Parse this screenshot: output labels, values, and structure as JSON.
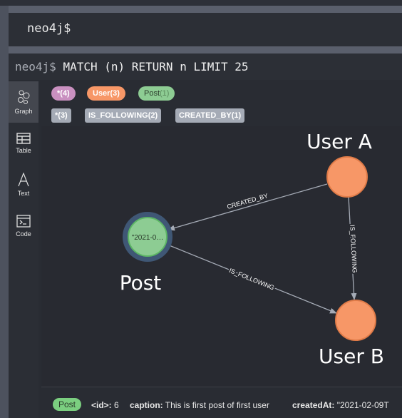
{
  "editor": {
    "prompt": "neo4j$"
  },
  "result": {
    "prompt": "neo4j$",
    "query": "MATCH (n) RETURN n LIMIT 25"
  },
  "sidebar": {
    "items": [
      {
        "label": "Graph",
        "icon": "graph-icon",
        "active": true
      },
      {
        "label": "Table",
        "icon": "table-icon"
      },
      {
        "label": "Text",
        "icon": "text-icon"
      },
      {
        "label": "Code",
        "icon": "code-icon"
      }
    ]
  },
  "legend": {
    "labels": [
      {
        "name": "*",
        "count": "(4)",
        "color": "#c990c0"
      },
      {
        "name": "User",
        "count": "(3)",
        "color": "#f79767"
      },
      {
        "name": "Post",
        "count": "(1)",
        "color": "#8dcc93"
      }
    ],
    "relationships": [
      {
        "text": "*(3)"
      },
      {
        "text": "IS_FOLLOWING(2)"
      },
      {
        "text": "CREATED_BY(1)"
      }
    ]
  },
  "graph": {
    "nodes": [
      {
        "id": "user-a",
        "caption": "User A",
        "color": "#f79767"
      },
      {
        "id": "post",
        "caption": "Post",
        "inner": "\"2021-0…",
        "color": "#8dcc93",
        "selected": true
      },
      {
        "id": "user-b",
        "caption": "User B",
        "color": "#f79767"
      }
    ],
    "edges": [
      {
        "from": "user-a",
        "to": "post",
        "label": "CREATED_BY"
      },
      {
        "from": "user-a",
        "to": "user-b",
        "label": "IS_FOLLOWING"
      },
      {
        "from": "post",
        "to": "user-b",
        "label": "IS_FOLLOWING"
      }
    ]
  },
  "footer": {
    "label": "Post",
    "props": [
      {
        "key": "<id>:",
        "value": "6"
      },
      {
        "key": "caption:",
        "value": "This is first post of first user"
      },
      {
        "key": "createdAt:",
        "value": "\"2021-02-09T"
      }
    ]
  }
}
